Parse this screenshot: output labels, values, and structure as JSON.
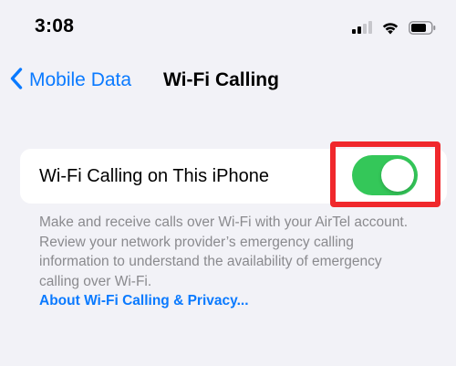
{
  "status_bar": {
    "time": "3:08",
    "icons": [
      "cellular-signal-icon",
      "wifi-icon",
      "battery-icon"
    ]
  },
  "nav": {
    "back_label": "Mobile Data",
    "title": "Wi-Fi Calling"
  },
  "setting": {
    "label": "Wi-Fi Calling on This iPhone",
    "toggle_on": true
  },
  "footer": {
    "text": "Make and receive calls over Wi-Fi with your AirTel account. Review your network provider’s emergency calling information to understand the availability of emergency calling over Wi-Fi.",
    "link": "About Wi-Fi Calling & Privacy..."
  },
  "colors": {
    "accent": "#0a7aff",
    "toggle_on": "#34c759",
    "highlight": "#f0282c",
    "background": "#f2f2f7"
  }
}
